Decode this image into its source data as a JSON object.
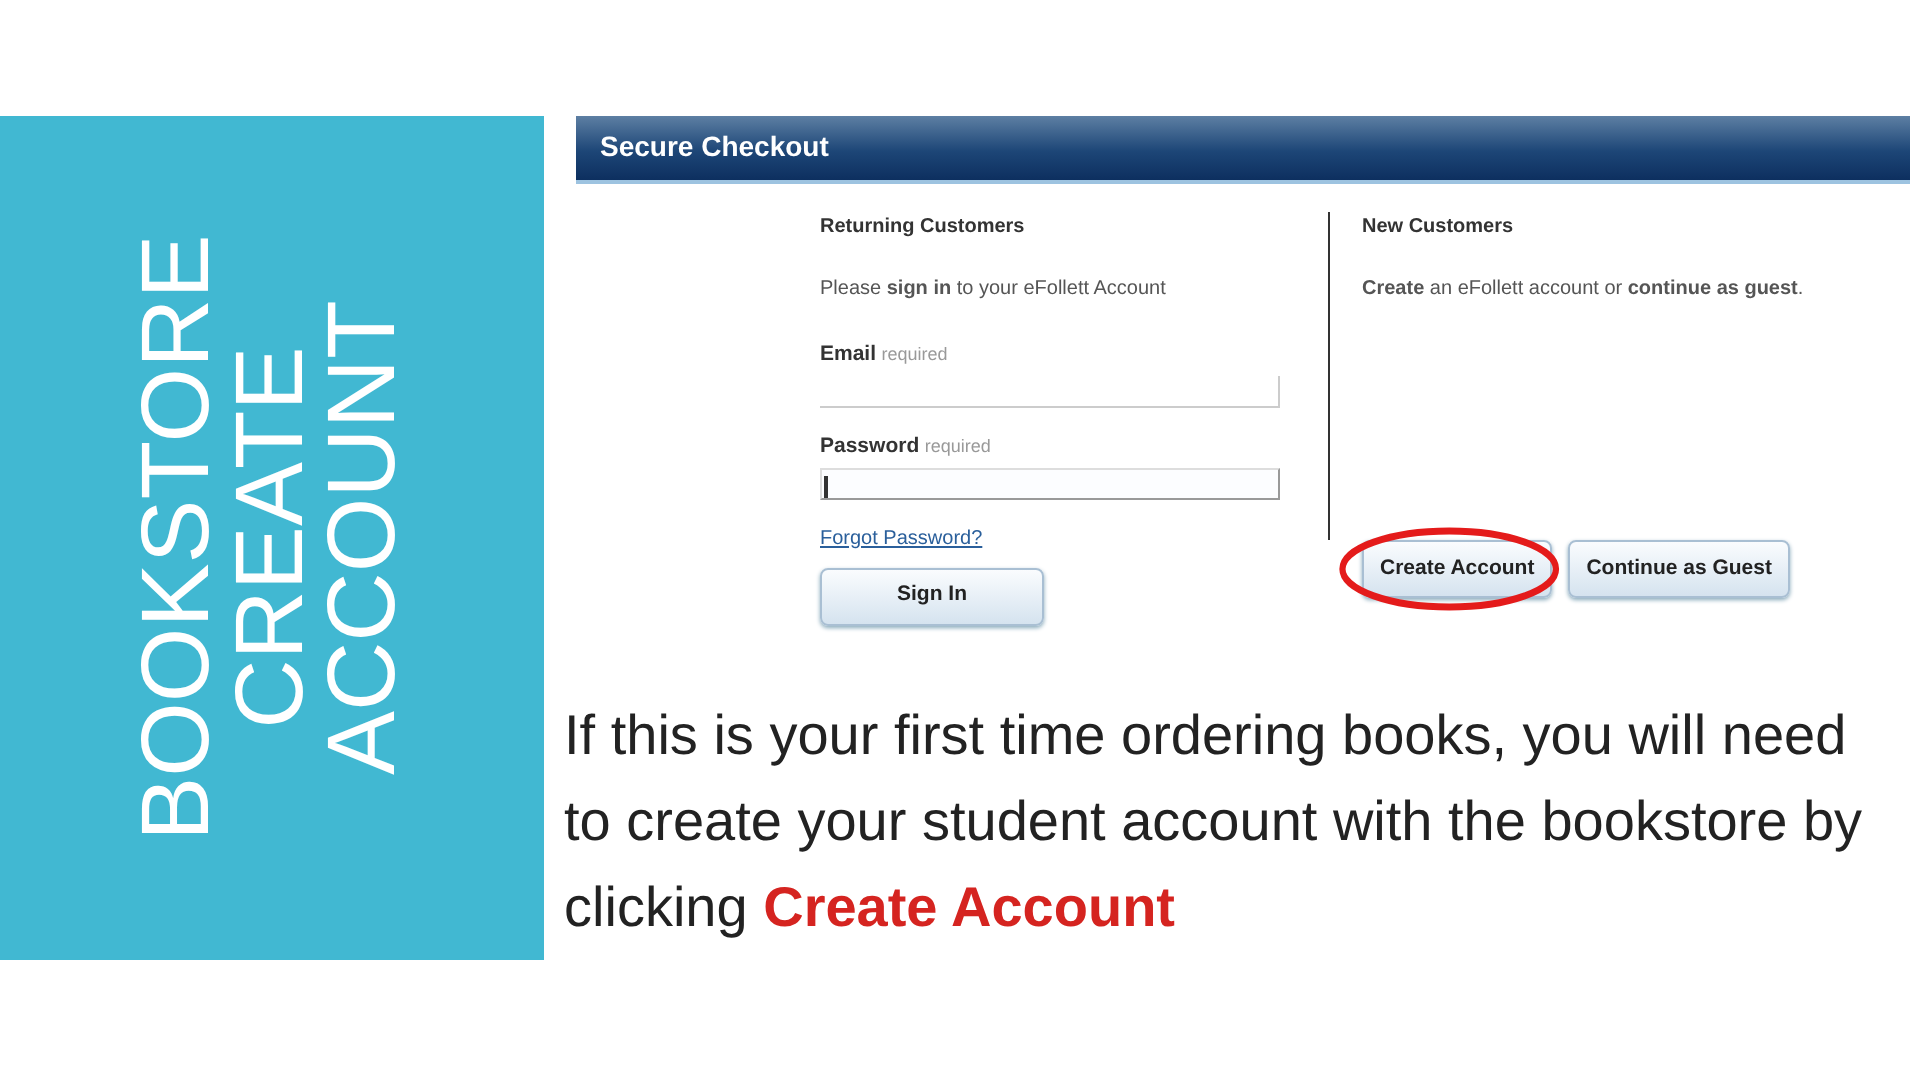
{
  "sidebar": {
    "title_lines": [
      "BOOKSTORE",
      "CREATE",
      "ACCOUNT"
    ]
  },
  "checkout": {
    "title": "Secure Checkout",
    "returning": {
      "heading": "Returning Customers",
      "intro": "Please **sign in** to your eFollett Account",
      "fields": [
        {
          "label": "Email",
          "hint": "required",
          "focused": false
        },
        {
          "label": "Password",
          "hint": "required",
          "focused": true
        }
      ],
      "forgot_link": "Forgot Password?",
      "button": "Sign In"
    },
    "new": {
      "heading": "New Customers",
      "intro": "**Create** an eFollett account or **continue as guest**.",
      "buttons": [
        {
          "label": "Create Account",
          "circled": true
        },
        {
          "label": "Continue as Guest",
          "circled": false
        }
      ]
    }
  },
  "caption": {
    "text": "If this is your first time ordering books, you will need to create your student account with the bookstore by clicking **Create Account**"
  }
}
